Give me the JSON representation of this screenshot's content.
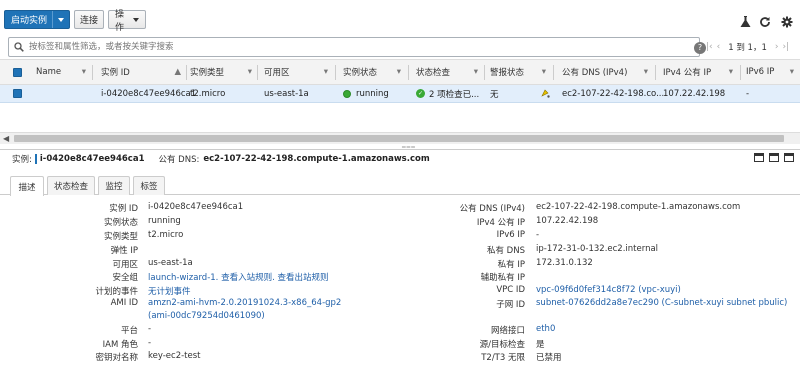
{
  "toolbar": {
    "launch_label": "启动实例",
    "connect_label": "连接",
    "actions_label": "操作"
  },
  "search": {
    "placeholder": "按标签和属性筛选，或者按关键字搜索",
    "pagination": "1 到 1，1"
  },
  "table": {
    "headers": [
      "Name",
      "实例 ID",
      "实例类型",
      "可用区",
      "实例状态",
      "状态检查",
      "警报状态",
      "公有 DNS (IPv4)",
      "IPv4 公有 IP",
      "IPv6 IP"
    ],
    "row": {
      "name": "",
      "instance_id": "i-0420e8c47ee946ca1",
      "instance_type": "t2.micro",
      "az": "us-east-1a",
      "state": "running",
      "status_check": "2 项检查已...",
      "alarm": "无",
      "public_dns": "ec2-107-22-42-198.co...",
      "ipv4": "107.22.42.198",
      "ipv6": "-"
    }
  },
  "detail": {
    "instance_label": "实例:",
    "instance_id": "i-0420e8c47ee946ca1",
    "dns_label": "公有 DNS:",
    "dns_value": "ec2-107-22-42-198.compute-1.amazonaws.com",
    "tabs": [
      "描述",
      "状态检查",
      "监控",
      "标签"
    ],
    "left": [
      {
        "k": "实例 ID",
        "v": "i-0420e8c47ee946ca1"
      },
      {
        "k": "实例状态",
        "v": "running"
      },
      {
        "k": "实例类型",
        "v": "t2.micro"
      },
      {
        "k": "弹性 IP",
        "v": ""
      },
      {
        "k": "可用区",
        "v": "us-east-1a"
      },
      {
        "k": "安全组",
        "v": "launch-wizard-1. 查看入站规则. 查看出站规则"
      },
      {
        "k": "计划的事件",
        "v": "无计划事件"
      },
      {
        "k": "AMI ID",
        "v": "amzn2-ami-hvm-2.0.20191024.3-x86_64-gp2",
        "v2": "(ami-00dc79254d0461090)"
      },
      {
        "k": "平台",
        "v": "-"
      },
      {
        "k": "IAM 角色",
        "v": "-"
      },
      {
        "k": "密钥对名称",
        "v": "key-ec2-test"
      }
    ],
    "right": [
      {
        "k": "公有 DNS (IPv4)",
        "v": "ec2-107-22-42-198.compute-1.amazonaws.com"
      },
      {
        "k": "IPv4 公有 IP",
        "v": "107.22.42.198"
      },
      {
        "k": "IPv6 IP",
        "v": "-"
      },
      {
        "k": "私有 DNS",
        "v": "ip-172-31-0-132.ec2.internal"
      },
      {
        "k": "私有 IP",
        "v": "172.31.0.132"
      },
      {
        "k": "辅助私有 IP",
        "v": ""
      },
      {
        "k": "VPC ID",
        "v": "vpc-09f6d0fef314c8f72 (vpc-xuyi)"
      },
      {
        "k": "子网 ID",
        "v": "subnet-07626dd2a8e7ec290 (C-subnet-xuyi subnet pbulic)"
      },
      {
        "k": "网络接口",
        "v": "eth0"
      },
      {
        "k": "源/目标检查",
        "v": "是"
      },
      {
        "k": "T2/T3 无限",
        "v": "已禁用"
      }
    ]
  }
}
